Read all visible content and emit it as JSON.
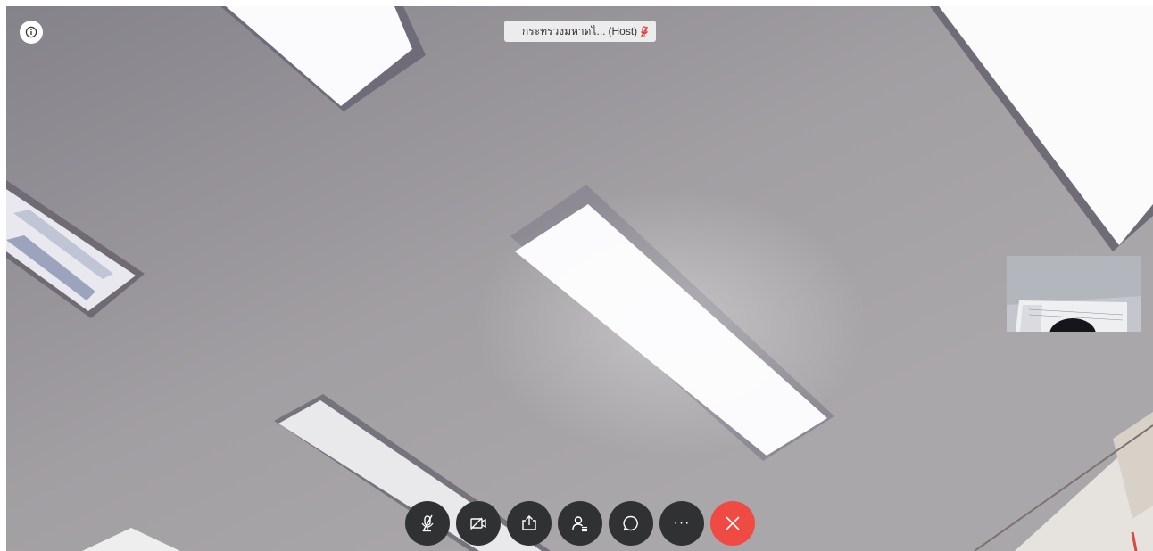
{
  "meeting": {
    "host_name": "กระทรวงมหาดไ...",
    "host_role": "(Host)"
  },
  "controls": [
    {
      "name": "mute-button",
      "icon": "microphone-muted-icon"
    },
    {
      "name": "video-button",
      "icon": "video-camera-off-icon"
    },
    {
      "name": "share-button",
      "icon": "share-screen-icon"
    },
    {
      "name": "participants-button",
      "icon": "participants-icon"
    },
    {
      "name": "chat-button",
      "icon": "chat-bubble-icon"
    },
    {
      "name": "more-button",
      "icon": "more-options-icon",
      "label": "···"
    },
    {
      "name": "end-call-button",
      "icon": "close-icon"
    }
  ],
  "colors": {
    "control_bg": "#2f3133",
    "end_call": "#ef4a44",
    "muted_indicator": "#e53935",
    "name_tag_bg": "#ececec"
  }
}
